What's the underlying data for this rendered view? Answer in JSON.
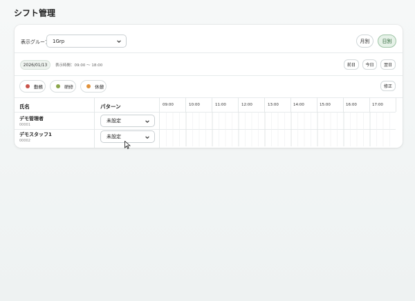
{
  "page": {
    "title": "シフト管理"
  },
  "toolbar": {
    "group_label": "表示グループ",
    "group_value": "1Grp",
    "view_month": "月別",
    "view_day": "日別",
    "active_view": "日別"
  },
  "date_bar": {
    "date": "2026/01/13",
    "display_time_label": "表示時間：09:00 〜 18:00",
    "prev_day": "前日",
    "today": "今日",
    "next_day": "翌日"
  },
  "legend": {
    "items": [
      {
        "label": "勤務",
        "color": "#c9524a"
      },
      {
        "label": "研修",
        "color": "#8aa64a"
      },
      {
        "label": "休憩",
        "color": "#e0913a"
      }
    ],
    "edit_label": "修正"
  },
  "table": {
    "col_name": "氏名",
    "col_pattern": "パターン",
    "hours": [
      "09:00",
      "10:00",
      "11:00",
      "12:00",
      "13:00",
      "14:00",
      "15:00",
      "16:00",
      "17:00"
    ],
    "rows": [
      {
        "name": "デモ管理者",
        "id": "00001",
        "pattern": "未設定"
      },
      {
        "name": "デモスタッフ1",
        "id": "00002",
        "pattern": "未設定"
      }
    ]
  },
  "icons": {
    "chevron": "chevron-down-icon",
    "cursor": "mouse-pointer-icon"
  }
}
